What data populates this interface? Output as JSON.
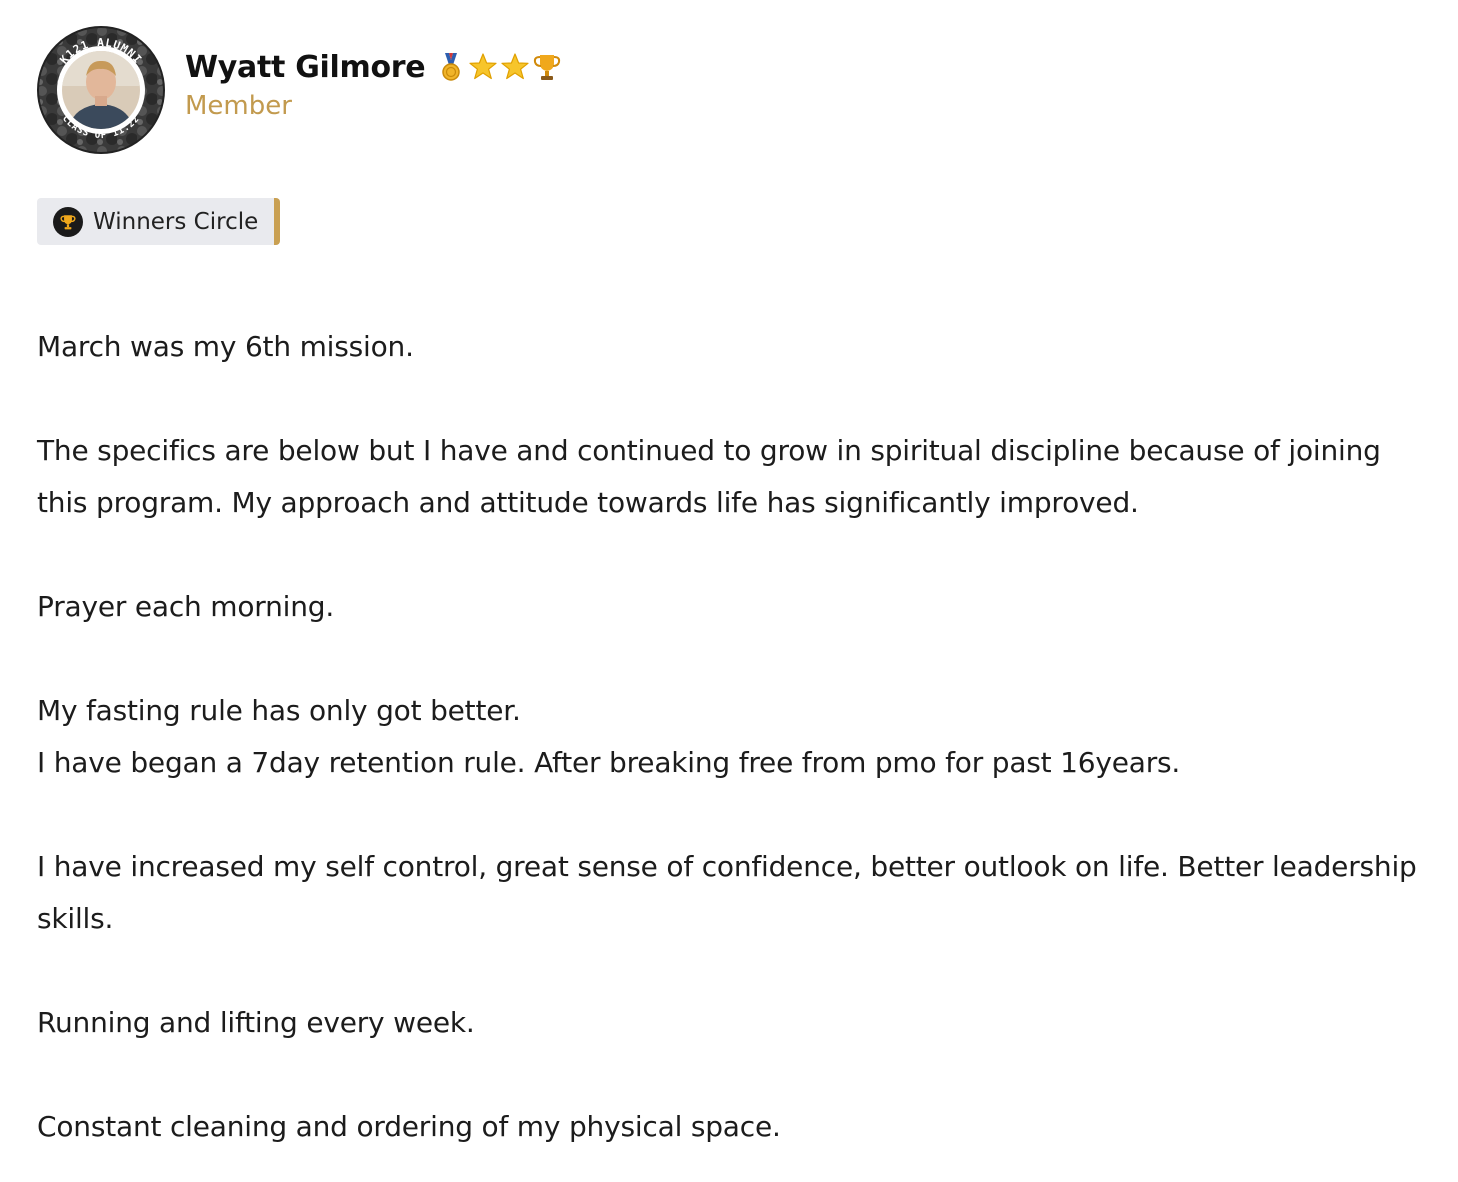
{
  "author": {
    "name": "Wyatt Gilmore",
    "role": "Member",
    "avatar": {
      "ring_text_top": "K121 ALUMNI",
      "ring_text_bottom": "CLASS OF 11.22"
    },
    "badges": [
      {
        "icon": "medal-icon"
      },
      {
        "icon": "star-icon"
      },
      {
        "icon": "star-icon"
      },
      {
        "icon": "trophy-icon"
      }
    ]
  },
  "category": {
    "label": "Winners Circle",
    "icon": "trophy-icon",
    "accent_color": "#c9a052"
  },
  "colors": {
    "role": "#c29a4e",
    "tag_background": "#e9eaee",
    "text": "#1c1c1c"
  },
  "post": {
    "paragraphs": [
      {
        "lines": [
          "March was my 6th mission."
        ]
      },
      {
        "lines": [
          "The specifics are below but I have and continued to grow in spiritual discipline because of joining this program. My approach and attitude towards life has significantly improved."
        ]
      },
      {
        "lines": [
          "Prayer each morning."
        ]
      },
      {
        "lines": [
          "My fasting rule has only got better.",
          "I have began a 7day retention rule. After breaking free from pmo for past 16years."
        ]
      },
      {
        "lines": [
          "I have increased my self control, great sense of confidence, better outlook on life. Better leadership skills."
        ]
      },
      {
        "lines": [
          "Running and lifting every week."
        ]
      },
      {
        "lines": [
          "Constant cleaning and ordering of my physical space."
        ]
      }
    ]
  }
}
